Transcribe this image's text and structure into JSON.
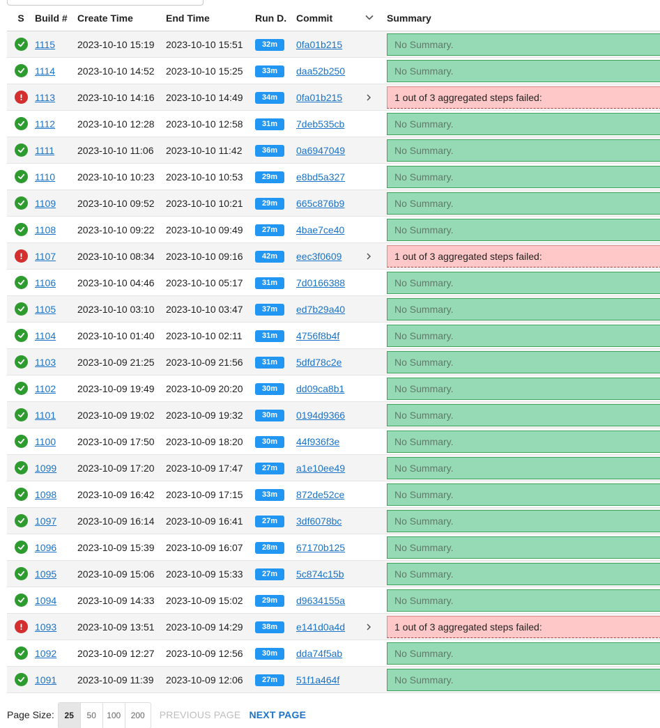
{
  "headers": {
    "status": "S",
    "build": "Build #",
    "create": "Create Time",
    "end": "End Time",
    "run": "Run D.",
    "commit": "Commit",
    "summary": "Summary"
  },
  "colors": {
    "success": "#2e9b2f",
    "failure": "#d32f2f",
    "badge": "#2196f3",
    "summary_ok": "#96dab5",
    "summary_fail": "#ffc8c8",
    "link": "#1a73c8"
  },
  "rows": [
    {
      "status": "success",
      "build": "1115",
      "create": "2023-10-10 15:19",
      "end": "2023-10-10 15:51",
      "dur": "32m",
      "commit": "0fa01b215",
      "summary": "No Summary."
    },
    {
      "status": "success",
      "build": "1114",
      "create": "2023-10-10 14:52",
      "end": "2023-10-10 15:25",
      "dur": "33m",
      "commit": "daa52b250",
      "summary": "No Summary."
    },
    {
      "status": "failure",
      "build": "1113",
      "create": "2023-10-10 14:16",
      "end": "2023-10-10 14:49",
      "dur": "34m",
      "commit": "0fa01b215",
      "summary": "1 out of 3 aggregated steps failed:"
    },
    {
      "status": "success",
      "build": "1112",
      "create": "2023-10-10 12:28",
      "end": "2023-10-10 12:58",
      "dur": "31m",
      "commit": "7deb535cb",
      "summary": "No Summary."
    },
    {
      "status": "success",
      "build": "1111",
      "create": "2023-10-10 11:06",
      "end": "2023-10-10 11:42",
      "dur": "36m",
      "commit": "0a6947049",
      "summary": "No Summary."
    },
    {
      "status": "success",
      "build": "1110",
      "create": "2023-10-10 10:23",
      "end": "2023-10-10 10:53",
      "dur": "29m",
      "commit": "e8bd5a327",
      "summary": "No Summary."
    },
    {
      "status": "success",
      "build": "1109",
      "create": "2023-10-10 09:52",
      "end": "2023-10-10 10:21",
      "dur": "29m",
      "commit": "665c876b9",
      "summary": "No Summary."
    },
    {
      "status": "success",
      "build": "1108",
      "create": "2023-10-10 09:22",
      "end": "2023-10-10 09:49",
      "dur": "27m",
      "commit": "4bae7ce40",
      "summary": "No Summary."
    },
    {
      "status": "failure",
      "build": "1107",
      "create": "2023-10-10 08:34",
      "end": "2023-10-10 09:16",
      "dur": "42m",
      "commit": "eec3f0609",
      "summary": "1 out of 3 aggregated steps failed:"
    },
    {
      "status": "success",
      "build": "1106",
      "create": "2023-10-10 04:46",
      "end": "2023-10-10 05:17",
      "dur": "31m",
      "commit": "7d0166388",
      "summary": "No Summary."
    },
    {
      "status": "success",
      "build": "1105",
      "create": "2023-10-10 03:10",
      "end": "2023-10-10 03:47",
      "dur": "37m",
      "commit": "ed7b29a40",
      "summary": "No Summary."
    },
    {
      "status": "success",
      "build": "1104",
      "create": "2023-10-10 01:40",
      "end": "2023-10-10 02:11",
      "dur": "31m",
      "commit": "4756f8b4f",
      "summary": "No Summary."
    },
    {
      "status": "success",
      "build": "1103",
      "create": "2023-10-09 21:25",
      "end": "2023-10-09 21:56",
      "dur": "31m",
      "commit": "5dfd78c2e",
      "summary": "No Summary."
    },
    {
      "status": "success",
      "build": "1102",
      "create": "2023-10-09 19:49",
      "end": "2023-10-09 20:20",
      "dur": "30m",
      "commit": "dd09ca8b1",
      "summary": "No Summary."
    },
    {
      "status": "success",
      "build": "1101",
      "create": "2023-10-09 19:02",
      "end": "2023-10-09 19:32",
      "dur": "30m",
      "commit": "0194d9366",
      "summary": "No Summary."
    },
    {
      "status": "success",
      "build": "1100",
      "create": "2023-10-09 17:50",
      "end": "2023-10-09 18:20",
      "dur": "30m",
      "commit": "44f936f3e",
      "summary": "No Summary."
    },
    {
      "status": "success",
      "build": "1099",
      "create": "2023-10-09 17:20",
      "end": "2023-10-09 17:47",
      "dur": "27m",
      "commit": "a1e10ee49",
      "summary": "No Summary."
    },
    {
      "status": "success",
      "build": "1098",
      "create": "2023-10-09 16:42",
      "end": "2023-10-09 17:15",
      "dur": "33m",
      "commit": "872de52ce",
      "summary": "No Summary."
    },
    {
      "status": "success",
      "build": "1097",
      "create": "2023-10-09 16:14",
      "end": "2023-10-09 16:41",
      "dur": "27m",
      "commit": "3df6078bc",
      "summary": "No Summary."
    },
    {
      "status": "success",
      "build": "1096",
      "create": "2023-10-09 15:39",
      "end": "2023-10-09 16:07",
      "dur": "28m",
      "commit": "67170b125",
      "summary": "No Summary."
    },
    {
      "status": "success",
      "build": "1095",
      "create": "2023-10-09 15:06",
      "end": "2023-10-09 15:33",
      "dur": "27m",
      "commit": "5c874c15b",
      "summary": "No Summary."
    },
    {
      "status": "success",
      "build": "1094",
      "create": "2023-10-09 14:33",
      "end": "2023-10-09 15:02",
      "dur": "29m",
      "commit": "d9634155a",
      "summary": "No Summary."
    },
    {
      "status": "failure",
      "build": "1093",
      "create": "2023-10-09 13:51",
      "end": "2023-10-09 14:29",
      "dur": "38m",
      "commit": "e141d0a4d",
      "summary": "1 out of 3 aggregated steps failed:"
    },
    {
      "status": "success",
      "build": "1092",
      "create": "2023-10-09 12:27",
      "end": "2023-10-09 12:56",
      "dur": "30m",
      "commit": "dda74f5ab",
      "summary": "No Summary."
    },
    {
      "status": "success",
      "build": "1091",
      "create": "2023-10-09 11:39",
      "end": "2023-10-09 12:06",
      "dur": "27m",
      "commit": "51f1a464f",
      "summary": "No Summary."
    }
  ],
  "pager": {
    "label": "Page Size:",
    "sizes": [
      "25",
      "50",
      "100",
      "200"
    ],
    "active_size": "25",
    "prev": "PREVIOUS PAGE",
    "next": "NEXT PAGE"
  }
}
